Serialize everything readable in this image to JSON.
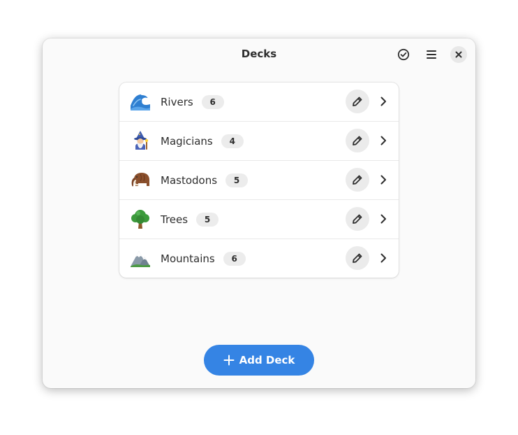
{
  "window": {
    "title": "Decks"
  },
  "header": {
    "select_icon": "check-circle-icon",
    "menu_icon": "hamburger-menu-icon",
    "close_icon": "close-icon"
  },
  "decks": [
    {
      "name": "Rivers",
      "count": "6",
      "icon": "wave-emoji"
    },
    {
      "name": "Magicians",
      "count": "4",
      "icon": "mage-emoji"
    },
    {
      "name": "Mastodons",
      "count": "5",
      "icon": "mammoth-emoji"
    },
    {
      "name": "Trees",
      "count": "5",
      "icon": "tree-emoji"
    },
    {
      "name": "Mountains",
      "count": "6",
      "icon": "mountain-emoji"
    }
  ],
  "add_button": {
    "label": "Add Deck",
    "icon": "plus-icon"
  },
  "colors": {
    "accent": "#3584e4",
    "window_bg": "#fafafa",
    "text": "#2e2e2e"
  }
}
